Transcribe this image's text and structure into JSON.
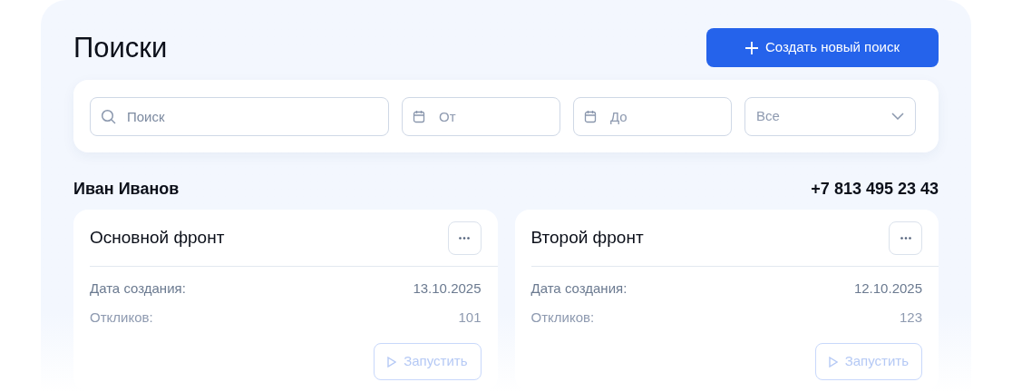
{
  "title": "Поиски",
  "create_button": "Создать новый поиск",
  "filters": {
    "search": {
      "placeholder": "Поиск"
    },
    "date_from": {
      "placeholder": "От"
    },
    "date_to": {
      "placeholder": "До"
    },
    "status_select": {
      "value": "Все"
    }
  },
  "person": {
    "name": "Иван Иванов",
    "phone": "+7 813 495 23 43"
  },
  "cards": [
    {
      "title": "Основной фронт",
      "rows": [
        {
          "label": "Дата создания:",
          "value": "13.10.2025"
        },
        {
          "label": "Откликов:",
          "value": "101"
        }
      ],
      "action": "Запустить"
    },
    {
      "title": "Второй фронт",
      "rows": [
        {
          "label": "Дата создания:",
          "value": "12.10.2025"
        },
        {
          "label": "Откликов:",
          "value": "123"
        }
      ],
      "action": "Запустить"
    }
  ]
}
